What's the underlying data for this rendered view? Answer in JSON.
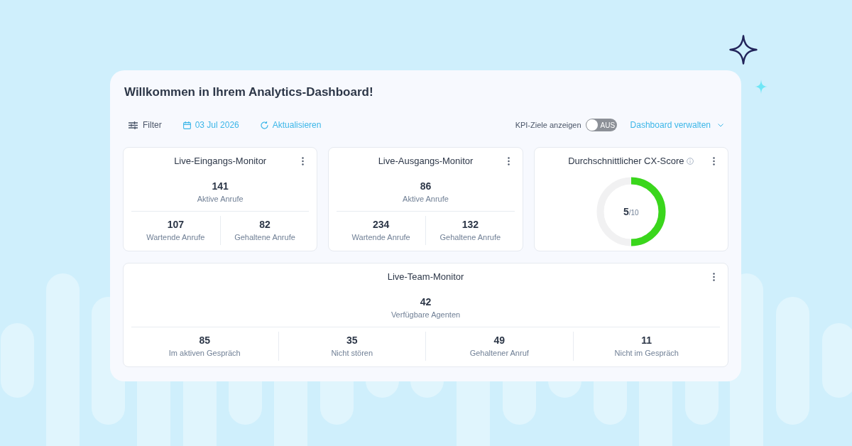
{
  "title": "Willkommen in Ihrem Analytics-Dashboard!",
  "toolbar": {
    "actions": [
      {
        "kind": "filter",
        "label": "Filter"
      },
      {
        "kind": "date",
        "label": "03 Jul 2026"
      },
      {
        "kind": "refresh",
        "label": "Aktualisieren"
      }
    ],
    "kpi_toggle": {
      "label": "KPI-Ziele anzeigen",
      "on": false,
      "state_text": "AUS"
    },
    "manage_menu": {
      "label": "Dashboard verwalten"
    }
  },
  "widget_rows": [
    {
      "widgets": [
        {
          "kind": "monitor",
          "title": "Live-Eingangs-Monitor",
          "primary": {
            "value": "141",
            "label": "Aktive Anrufe"
          },
          "stats": [
            {
              "value": "107",
              "label": "Wartende Anrufe"
            },
            {
              "value": "82",
              "label": "Gehaltene Anrufe"
            }
          ]
        },
        {
          "kind": "monitor",
          "title": "Live-Ausgangs-Monitor",
          "primary": {
            "value": "86",
            "label": "Aktive Anrufe"
          },
          "stats": [
            {
              "value": "234",
              "label": "Wartende Anrufe"
            },
            {
              "value": "132",
              "label": "Gehaltene Anrufe"
            }
          ]
        },
        {
          "kind": "score",
          "title": "Durchschnittlicher CX-Score",
          "score": {
            "value": "5",
            "max": "/10",
            "level": 0.5
          }
        }
      ]
    },
    {
      "widgets": [
        {
          "kind": "monitor",
          "title": "Live-Team-Monitor",
          "primary": {
            "value": "42",
            "label": "Verfügbare Agenten"
          },
          "stats": [
            {
              "value": "85",
              "label": "Im aktiven Gespräch"
            },
            {
              "value": "35",
              "label": "Nicht stören"
            },
            {
              "value": "49",
              "label": "Gehaltener Anruf"
            },
            {
              "value": "11",
              "label": "Nicht im Gespräch"
            }
          ]
        }
      ]
    }
  ]
}
